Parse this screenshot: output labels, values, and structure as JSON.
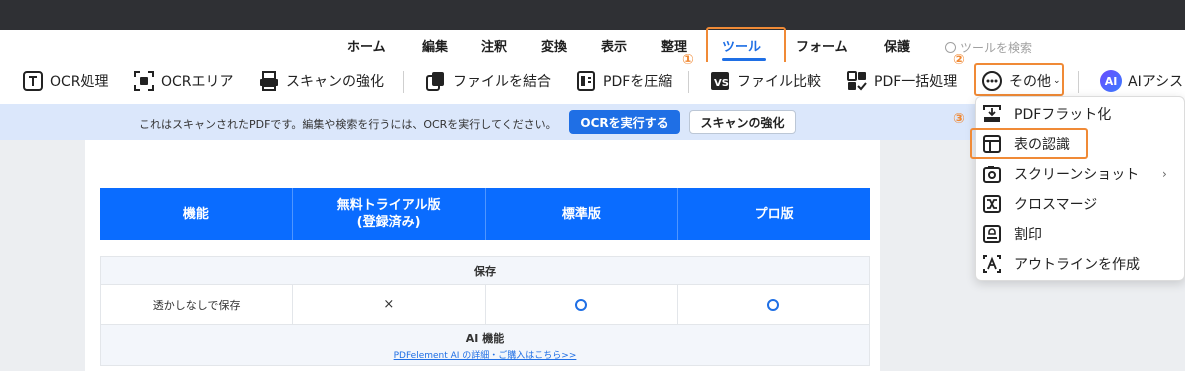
{
  "menu": {
    "items": [
      "ホーム",
      "編集",
      "注釈",
      "変換",
      "表示",
      "整理",
      "ツール",
      "フォーム",
      "保護"
    ],
    "active": "ツール",
    "search_placeholder": "ツールを検索"
  },
  "toolbar": {
    "ocr_process": "OCR処理",
    "ocr_area": "OCRエリア",
    "scan_enhance": "スキャンの強化",
    "combine_files": "ファイルを結合",
    "compress_pdf": "PDFを圧縮",
    "compare_files": "ファイル比較",
    "batch_pdf": "PDF一括処理",
    "more": "その他",
    "ai_badge": "AI",
    "ai_assist": "AIアシス"
  },
  "step_badges": {
    "one": "①",
    "two": "②",
    "three": "③"
  },
  "notice": {
    "text": "これはスキャンされたPDFです。編集や検索を行うには、OCRを実行してください。",
    "ocr_button": "OCRを実行する",
    "scan_button": "スキャンの強化"
  },
  "table": {
    "headers": [
      "機能",
      "無料トライアル版\n(登録済み)",
      "標準版",
      "プロ版"
    ],
    "section_save": "保存",
    "row_label": "透かしなしで保存",
    "row_values": [
      "×",
      "○",
      "○"
    ],
    "section_ai": "AI 機能",
    "ai_link": "PDFelement AI の詳細・ご購入はこちら>>"
  },
  "dropdown": {
    "items": [
      {
        "label": "PDFフラット化",
        "icon": "flatten-icon"
      },
      {
        "label": "表の認識",
        "icon": "table-recognition-icon"
      },
      {
        "label": "スクリーンショット",
        "icon": "screenshot-icon",
        "submenu": true
      },
      {
        "label": "クロスマージ",
        "icon": "cross-merge-icon"
      },
      {
        "label": "割印",
        "icon": "seal-icon"
      },
      {
        "label": "アウトラインを作成",
        "icon": "outline-icon"
      }
    ],
    "submenu_arrow": "›"
  },
  "colors": {
    "accent": "#1f6fe5",
    "highlight": "#f08a36",
    "titlebar": "#2f3034",
    "notice_bg": "#dbe7fb",
    "table_header": "#0a6cff"
  }
}
